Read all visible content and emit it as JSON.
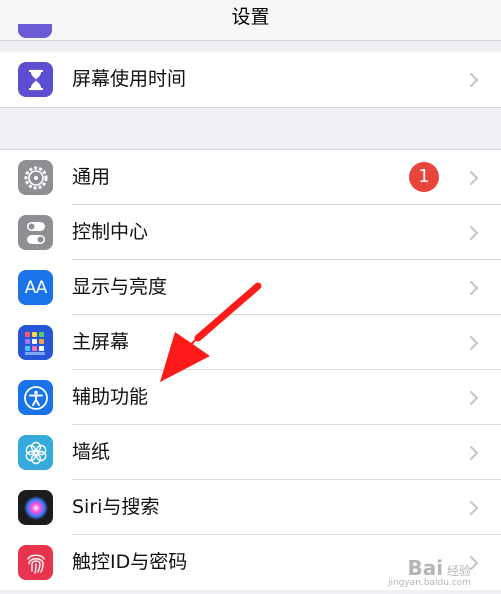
{
  "nav": {
    "title": "设置"
  },
  "group1": {
    "items": [
      {
        "label": "屏幕使用时间",
        "icon": "hourglass-icon",
        "color": "#5b4fcf"
      }
    ]
  },
  "group2": {
    "items": [
      {
        "label": "通用",
        "icon": "gear-icon",
        "color": "#8e8e93",
        "badge": "1"
      },
      {
        "label": "控制中心",
        "icon": "toggle-icon",
        "color": "#8e8e93"
      },
      {
        "label": "显示与亮度",
        "icon": "text-size-icon",
        "color": "#1a73e8",
        "icon_text": "AA"
      },
      {
        "label": "主屏幕",
        "icon": "home-grid-icon",
        "color": "#2557d6"
      },
      {
        "label": "辅助功能",
        "icon": "accessibility-icon",
        "color": "#1a73e8"
      },
      {
        "label": "墙纸",
        "icon": "flower-icon",
        "color": "#36aadc"
      },
      {
        "label": "Siri与搜索",
        "icon": "siri-icon",
        "color": "#1c1c1e"
      },
      {
        "label": "触控ID与密码",
        "icon": "fingerprint-icon",
        "color": "#e8344e"
      }
    ]
  },
  "watermark": {
    "brand": "Bai",
    "brand2": "经验",
    "url": "jingyan.baidu.com"
  },
  "badge_color": "#e8453c"
}
